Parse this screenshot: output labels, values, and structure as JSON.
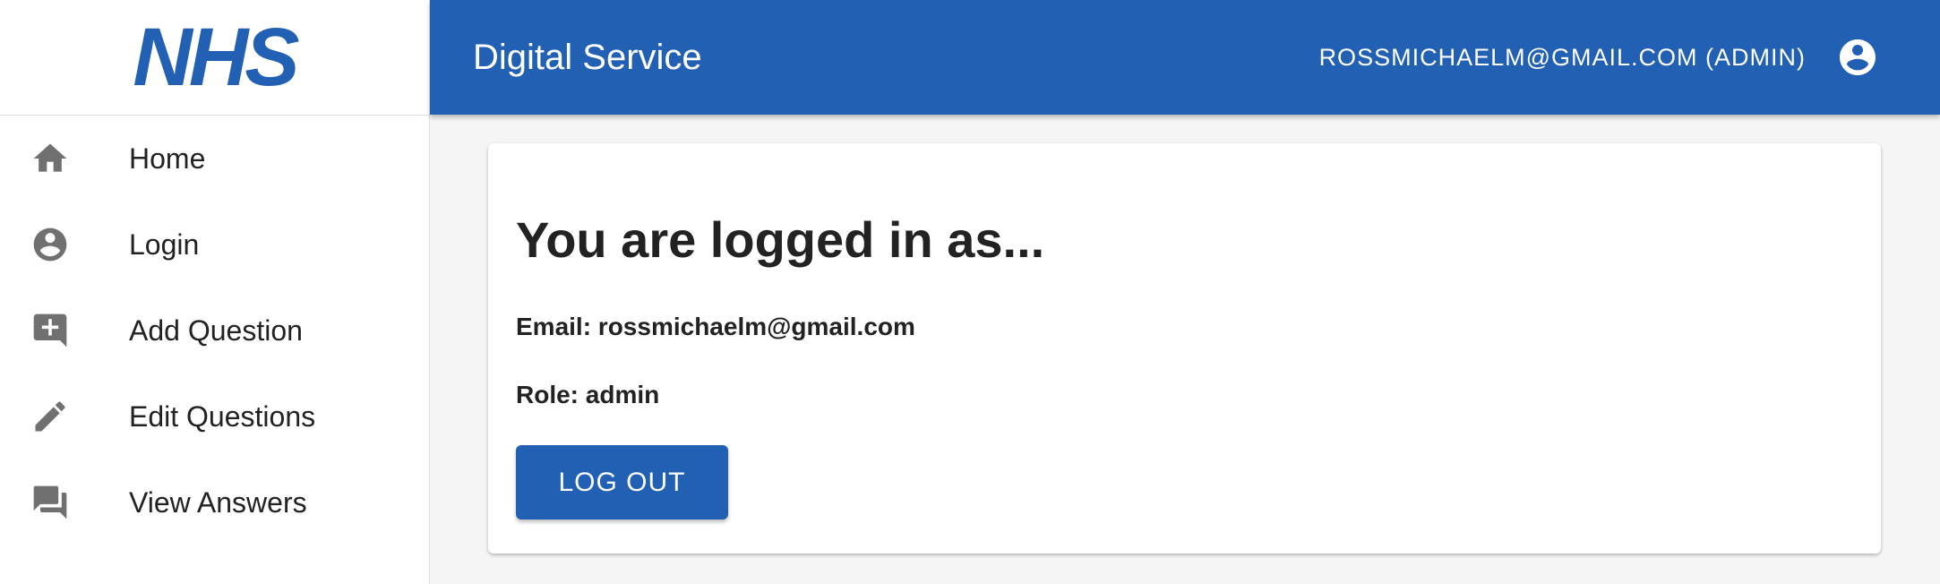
{
  "brand": {
    "logo_text": "NHS",
    "primary_color": "#2260b4"
  },
  "header": {
    "title": "Digital Service",
    "user_label": "ROSSMICHAELM@GMAIL.COM (ADMIN)",
    "user_icon": "account-circle-icon"
  },
  "sidebar": {
    "items": [
      {
        "label": "Home",
        "icon": "home-icon"
      },
      {
        "label": "Login",
        "icon": "account-circle-icon"
      },
      {
        "label": "Add Question",
        "icon": "add-comment-icon"
      },
      {
        "label": "Edit Questions",
        "icon": "pencil-icon"
      },
      {
        "label": "View Answers",
        "icon": "forum-icon"
      }
    ]
  },
  "main": {
    "heading": "You are logged in as...",
    "email_line": "Email: rossmichaelm@gmail.com",
    "role_line": "Role: admin",
    "logout_label": "LOG OUT"
  }
}
